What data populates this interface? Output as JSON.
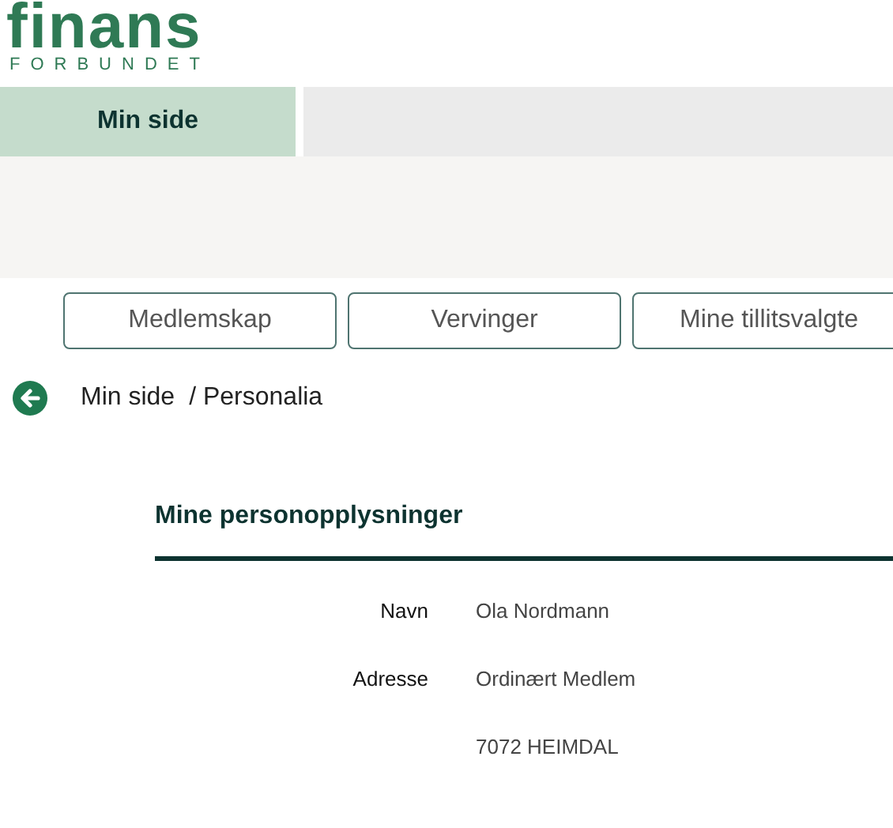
{
  "logo": {
    "wordmark": "finans",
    "subtitle": "FORBUNDET"
  },
  "tabs": [
    {
      "label": "Min side",
      "selected": true
    }
  ],
  "sub_nav": [
    "Medlemskap",
    "Vervinger",
    "Mine tillitsvalgte"
  ],
  "breadcrumb": {
    "items": [
      "Min side",
      "/ Personalia"
    ]
  },
  "section": {
    "title": "Mine personopplysninger",
    "fields": [
      {
        "label": "Navn",
        "value": "Ola Nordmann"
      },
      {
        "label": "Adresse",
        "value": "Ordinært Medlem"
      },
      {
        "value": "7072 HEIMDAL"
      }
    ]
  }
}
